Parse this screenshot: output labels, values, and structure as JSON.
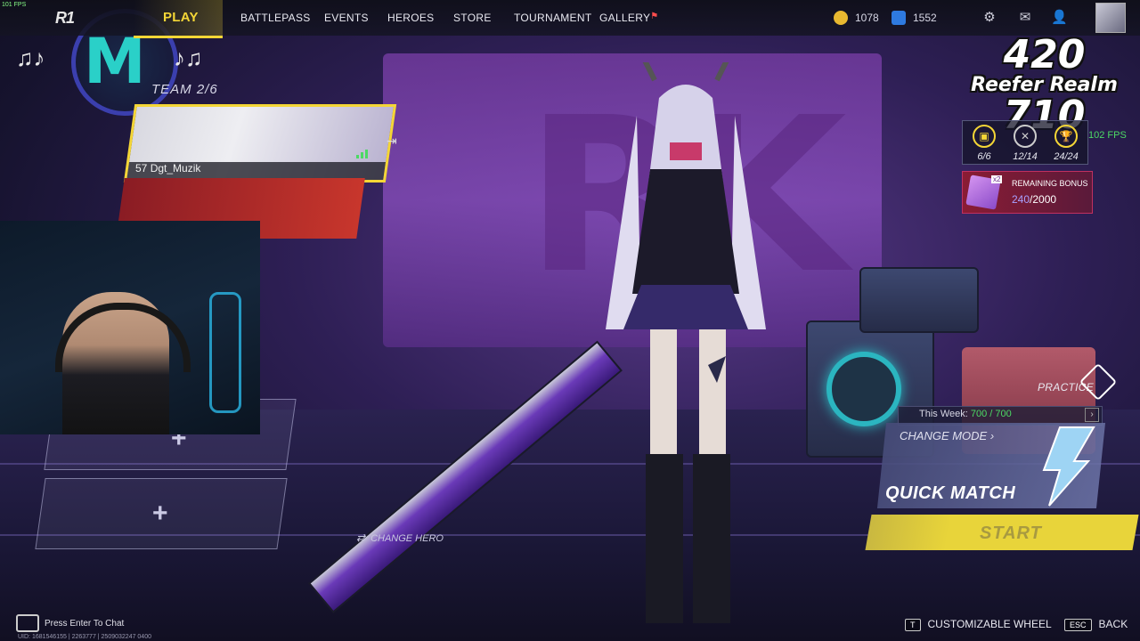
{
  "overlay": {
    "fps_small": "101 FPS",
    "stream_logo": {
      "line1": "420",
      "line2": "Reefer Realm",
      "line3": "710"
    }
  },
  "topbar": {
    "logo": "R1",
    "nav": [
      {
        "label": "PLAY",
        "active": true
      },
      {
        "label": "BATTLEPASS"
      },
      {
        "label": "EVENTS"
      },
      {
        "label": "HEROES"
      },
      {
        "label": "STORE"
      },
      {
        "label": "TOURNAMENT"
      },
      {
        "label": "GALLERY"
      }
    ],
    "currency": [
      {
        "value": "1078",
        "color": "#e8b830"
      },
      {
        "value": "1552",
        "color": "#2e7ae0"
      }
    ],
    "icons": [
      "gear-icon",
      "mail-icon",
      "friends-icon"
    ]
  },
  "team": {
    "label": "TEAM 2/6",
    "player": {
      "level": "57",
      "name": "Dgt_Muzik"
    }
  },
  "stats": [
    {
      "value": "6/6",
      "icon": "badge-icon"
    },
    {
      "value": "12/14",
      "icon": "crossed-swords-icon"
    },
    {
      "value": "24/24",
      "icon": "trophy-icon"
    }
  ],
  "fps": "102 FPS",
  "bonus": {
    "label": "REMAINING BONUS",
    "multiplier": "x2",
    "current": "240",
    "total": "/2000"
  },
  "mode": {
    "practice": "PRACTICE",
    "this_week_label": "This Week:",
    "this_week_value": "700 / 700",
    "change_mode": "CHANGE MODE",
    "mode_name": "QUICK MATCH",
    "start": "START"
  },
  "change_hero": "CHANGE HERO",
  "bottom": {
    "chat": "Press Enter To Chat",
    "uid": "UID: 1681546155 | 2263777 | 2509032247 0400",
    "hints": [
      {
        "key": "T",
        "label": "CUSTOMIZABLE WHEEL"
      },
      {
        "key": "ESC",
        "label": "BACK"
      }
    ]
  }
}
